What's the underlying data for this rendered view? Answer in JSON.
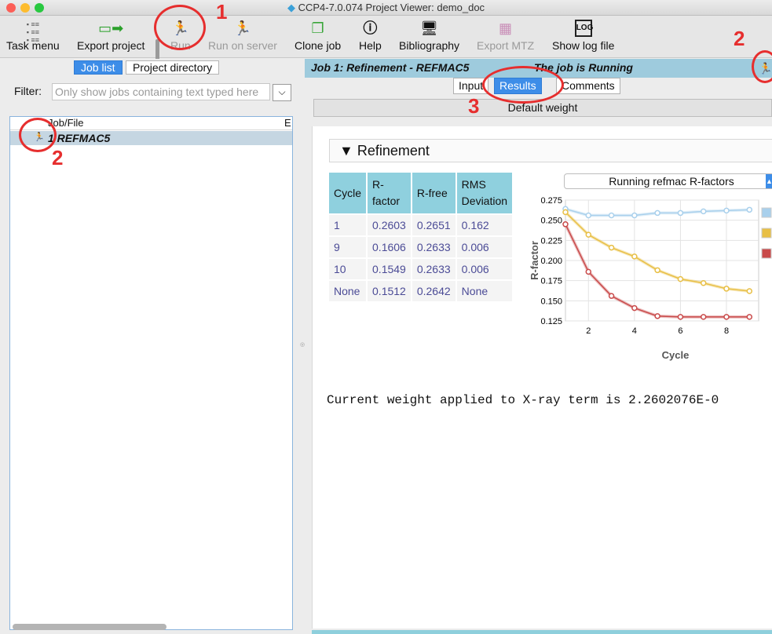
{
  "window": {
    "title": "CCP4-7.0.074 Project Viewer: demo_doc"
  },
  "toolbar": {
    "items": [
      {
        "label": "Task menu",
        "icon": "task-menu-icon",
        "enabled": true
      },
      {
        "label": "Export project",
        "icon": "export-project-icon",
        "enabled": true
      },
      {
        "label": "Run",
        "icon": "run-icon",
        "enabled": false
      },
      {
        "label": "Run on server",
        "icon": "run-on-server-icon",
        "enabled": false
      },
      {
        "label": "Clone job",
        "icon": "clone-job-icon",
        "enabled": true
      },
      {
        "label": "Help",
        "icon": "help-icon",
        "enabled": true
      },
      {
        "label": "Bibliography",
        "icon": "bibliography-icon",
        "enabled": true
      },
      {
        "label": "Export MTZ",
        "icon": "export-mtz-icon",
        "enabled": false
      },
      {
        "label": "Show log file",
        "icon": "log-file-icon",
        "enabled": true
      }
    ]
  },
  "left_panel": {
    "tabs": [
      {
        "label": "Job list",
        "active": true
      },
      {
        "label": "Project directory",
        "active": false
      }
    ],
    "filter_label": "Filter:",
    "filter_placeholder": "Only show jobs containing text typed here",
    "tree_header": "Job/File",
    "tree_header_col2": "E",
    "jobs": [
      {
        "label": "1 REFMAC5",
        "icon": "running-man-icon"
      }
    ]
  },
  "right_panel": {
    "job_title": "Job 1:  Refinement - REFMAC5",
    "job_status": "The job is Running",
    "tabs": [
      {
        "label": "Input",
        "active": false
      },
      {
        "label": "Results",
        "active": true
      },
      {
        "label": "Comments",
        "active": false
      }
    ],
    "subtitle": "Default weight",
    "section_title": "Refinement",
    "table": {
      "headers": [
        "Cycle",
        "R-\nfactor",
        "R-free",
        "RMS\nDeviation"
      ],
      "rows": [
        [
          "1",
          "0.2603",
          "0.2651",
          "0.162"
        ],
        [
          "9",
          "0.1606",
          "0.2633",
          "0.006"
        ],
        [
          "10",
          "0.1549",
          "0.2633",
          "0.006"
        ],
        [
          "None",
          "0.1512",
          "0.2642",
          "None"
        ]
      ]
    },
    "chart_selector": "Running refmac R-factors",
    "log_text": "Current weight applied to X-ray term is 2.2602076E-0"
  },
  "chart_data": {
    "type": "line",
    "xlabel": "Cycle",
    "ylabel": "R-factor",
    "xlim": [
      1,
      9.4
    ],
    "ylim": [
      0.125,
      0.275
    ],
    "xticks": [
      2,
      4,
      6,
      8
    ],
    "yticks": [
      0.125,
      0.15,
      0.175,
      0.2,
      0.225,
      0.25,
      0.275
    ],
    "x": [
      1,
      2,
      3,
      4,
      5,
      6,
      7,
      8,
      9
    ],
    "series": [
      {
        "color": "#a9d0ec",
        "values": [
          0.264,
          0.256,
          0.256,
          0.256,
          0.259,
          0.259,
          0.261,
          0.262,
          0.263
        ]
      },
      {
        "color": "#e8bf45",
        "values": [
          0.26,
          0.232,
          0.216,
          0.205,
          0.188,
          0.177,
          0.172,
          0.165,
          0.162
        ]
      },
      {
        "color": "#c94a4a",
        "values": [
          0.245,
          0.186,
          0.156,
          0.141,
          0.131,
          0.13,
          0.13,
          0.13,
          0.13
        ]
      }
    ],
    "grid": true,
    "legend": "right"
  },
  "annotations": [
    {
      "number": "1"
    },
    {
      "number": "2"
    },
    {
      "number": "2"
    },
    {
      "number": "3"
    }
  ],
  "colors": {
    "accent": "#3d8de8",
    "job_bar": "#9ecbdd",
    "table_header": "#8fd0de",
    "callout": "#e62e2e"
  }
}
